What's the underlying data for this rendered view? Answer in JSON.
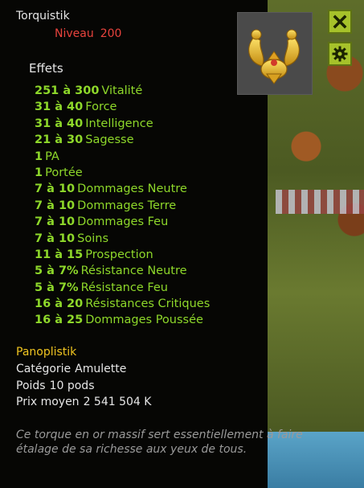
{
  "item": {
    "name": "Torquistik",
    "level_label": "Niveau",
    "level": "200",
    "icon": "golden-torque-amulet-icon"
  },
  "buttons": {
    "close": "close-icon",
    "settings": "gear-icon"
  },
  "effects_title": "Effets",
  "effects": [
    {
      "value": "251 à 300",
      "label": "Vitalité"
    },
    {
      "value": "31 à 40",
      "label": "Force"
    },
    {
      "value": "31 à 40",
      "label": "Intelligence"
    },
    {
      "value": "21 à 30",
      "label": "Sagesse"
    },
    {
      "value": "1",
      "label": "PA"
    },
    {
      "value": "1",
      "label": "Portée"
    },
    {
      "value": "7 à 10",
      "label": "Dommages Neutre"
    },
    {
      "value": "7 à 10",
      "label": "Dommages Terre"
    },
    {
      "value": "7 à 10",
      "label": "Dommages Feu"
    },
    {
      "value": "7 à 10",
      "label": "Soins"
    },
    {
      "value": "11 à 15",
      "label": "Prospection"
    },
    {
      "value": "5 à 7%",
      "label": "Résistance Neutre"
    },
    {
      "value": "5 à 7%",
      "label": "Résistance Feu"
    },
    {
      "value": "16 à 20",
      "label": "Résistances Critiques"
    },
    {
      "value": "16 à 25",
      "label": "Dommages Poussée"
    }
  ],
  "set_name": "Panoplistik",
  "info": {
    "category_label": "Catégorie",
    "category": "Amulette",
    "weight_label": "Poids",
    "weight": "10 pods",
    "price_label": "Prix moyen",
    "price": "2 541 504 K"
  },
  "description": "Ce torque en or massif sert essentiellement à faire étalage de sa richesse aux yeux de tous.",
  "colors": {
    "effect_green": "#8ed82a",
    "level_red": "#e8433d",
    "set_yellow": "#f0c420",
    "button_green": "#a6c22a"
  }
}
